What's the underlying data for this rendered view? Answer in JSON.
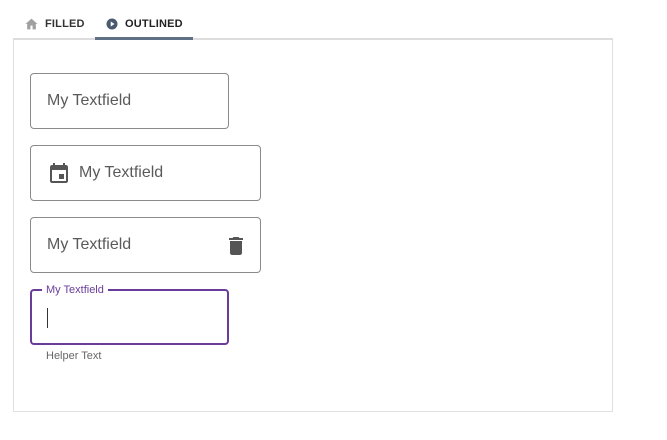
{
  "tabs": [
    {
      "label": "FILLED",
      "icon": "home-icon"
    },
    {
      "label": "OUTLINED",
      "icon": "play-circle-icon",
      "active": true
    }
  ],
  "fields": [
    {
      "placeholder": "My Textfield"
    },
    {
      "placeholder": "My Textfield",
      "leading_icon": "calendar-icon"
    },
    {
      "placeholder": "My Textfield",
      "trailing_icon": "trash-icon"
    },
    {
      "label": "My Textfield",
      "value": "",
      "focused": true,
      "helper": "Helper Text"
    }
  ],
  "colors": {
    "accent": "#6a3c9a",
    "tab_indicator": "#5f6f84",
    "border": "#8a8a8a"
  }
}
